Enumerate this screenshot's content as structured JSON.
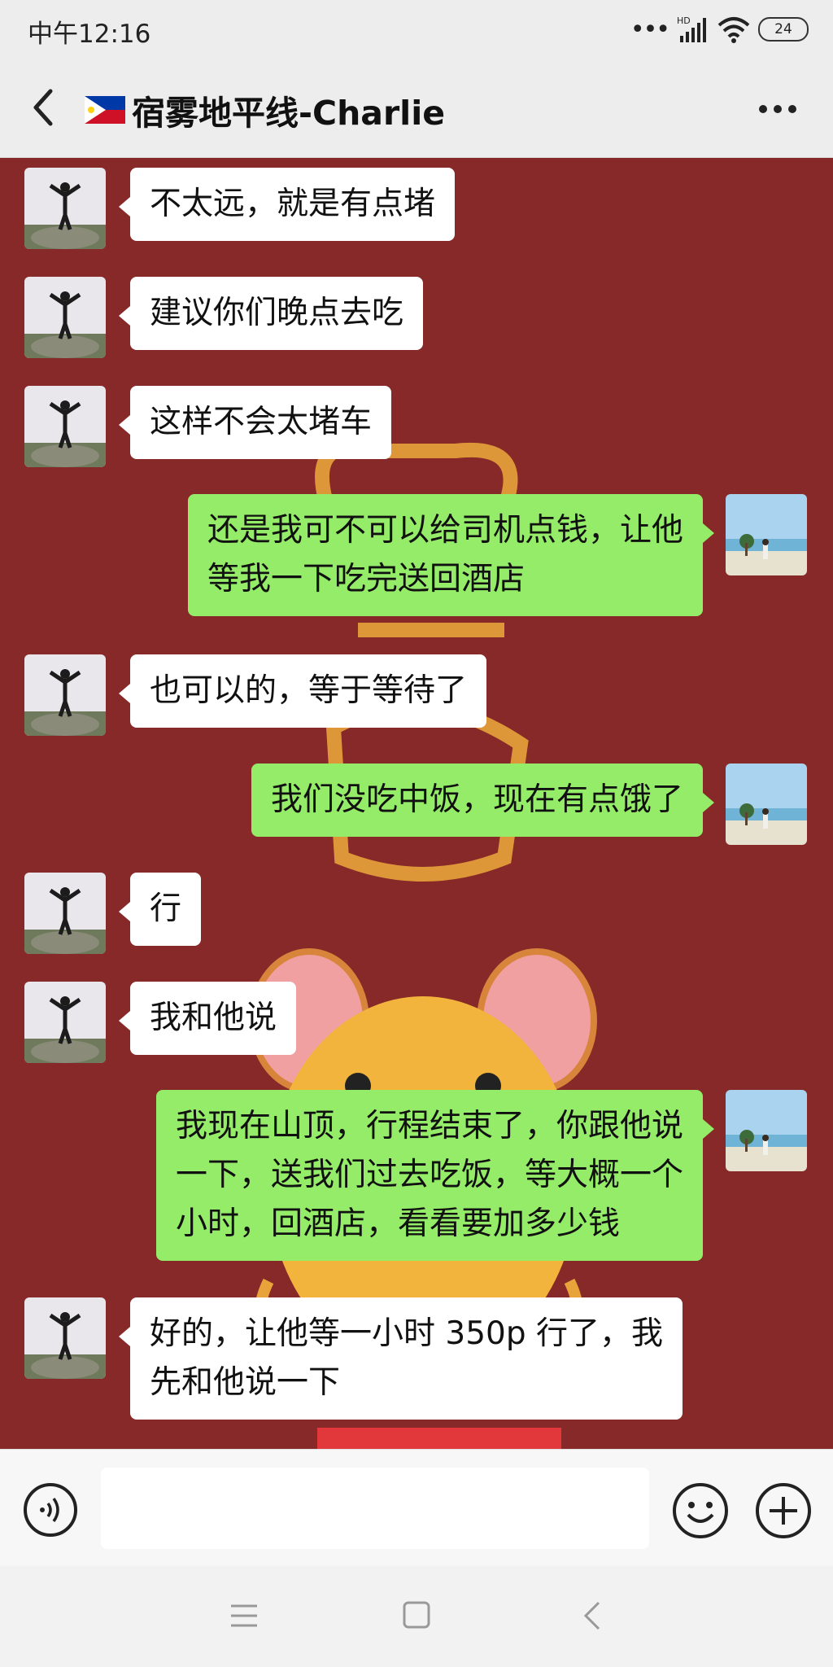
{
  "status_bar": {
    "time": "中午12:16",
    "signal_label": "HD",
    "battery": "24"
  },
  "header": {
    "title": "宿雾地平线-Charlie",
    "flag_icon": "philippines-flag-icon"
  },
  "messages": [
    {
      "side": "left",
      "lines": [
        "不太远，就是有点堵"
      ]
    },
    {
      "side": "left",
      "lines": [
        "建议你们晚点去吃"
      ]
    },
    {
      "side": "left",
      "lines": [
        "这样不会太堵车"
      ]
    },
    {
      "side": "right",
      "lines": [
        "还是我可不可以给司机点钱，让他",
        "等我一下吃完送回酒店"
      ]
    },
    {
      "side": "left",
      "lines": [
        "也可以的，等于等待了"
      ]
    },
    {
      "side": "right",
      "lines": [
        "我们没吃中饭，现在有点饿了"
      ]
    },
    {
      "side": "left",
      "lines": [
        "行"
      ]
    },
    {
      "side": "left",
      "lines": [
        "我和他说"
      ]
    },
    {
      "side": "right",
      "lines": [
        "我现在山顶，行程结束了，你跟他说",
        "一下，送我们过去吃饭，等大概一个",
        "小时，回酒店，看看要加多少钱"
      ]
    },
    {
      "side": "left",
      "lines": [
        "好的，让他等一小时 350p 行了，我",
        "先和他说一下"
      ]
    }
  ],
  "input": {
    "value": "",
    "placeholder": ""
  },
  "colors": {
    "chat_background": "#862928",
    "sent_bubble": "#95ec69",
    "received_bubble": "#ffffff"
  }
}
